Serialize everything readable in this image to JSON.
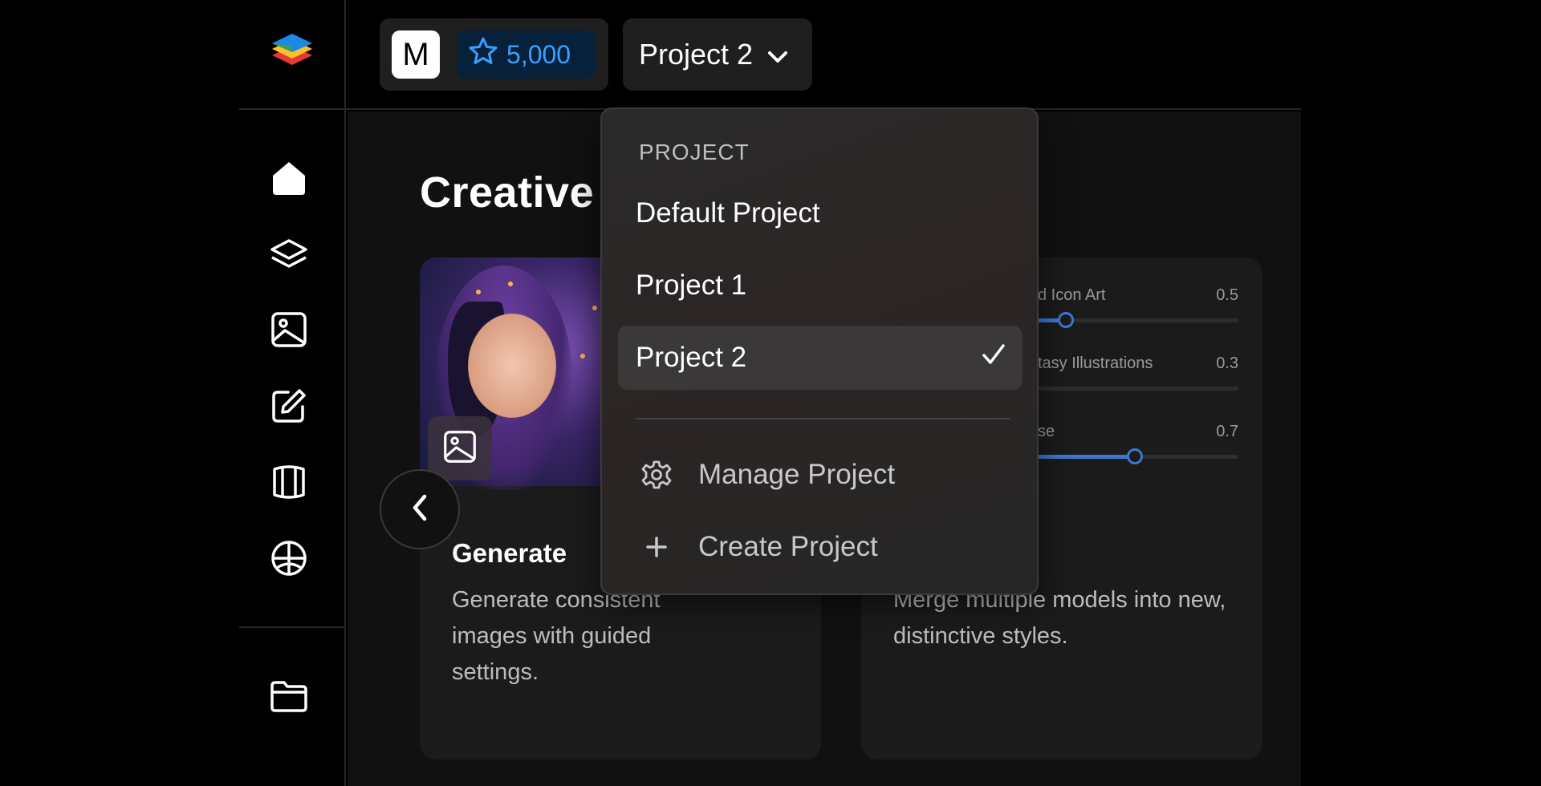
{
  "account": {
    "avatar_letter": "M",
    "credits": "5,000"
  },
  "project_selector": {
    "current": "Project 2"
  },
  "page": {
    "title": "Creative"
  },
  "cards": [
    {
      "title": "Generate",
      "description": "Generate consistent images with guided settings."
    },
    {
      "title": "",
      "description": "Merge multiple models into new, distinctive styles."
    }
  ],
  "merge_sliders": [
    {
      "label": "d Icon Art",
      "value": "0.5",
      "level": 0.5
    },
    {
      "label": "tasy Illustrations",
      "value": "0.3",
      "level": 0.3
    },
    {
      "label": "se",
      "value": "0.7",
      "level": 0.7
    }
  ],
  "dropdown": {
    "header": "PROJECT",
    "items": [
      {
        "label": "Default Project",
        "selected": false
      },
      {
        "label": "Project 1",
        "selected": false
      },
      {
        "label": "Project 2",
        "selected": true
      }
    ],
    "actions": {
      "manage": "Manage Project",
      "create": "Create Project"
    }
  },
  "colors": {
    "accent": "#3a78d4",
    "credits_text": "#3aa0ff",
    "credits_bg": "#07213a"
  },
  "icons": {
    "sidebar": [
      "home-icon",
      "layers-icon",
      "image-icon",
      "edit-icon",
      "3d-box-icon",
      "globe-icon",
      "folder-icon"
    ]
  }
}
